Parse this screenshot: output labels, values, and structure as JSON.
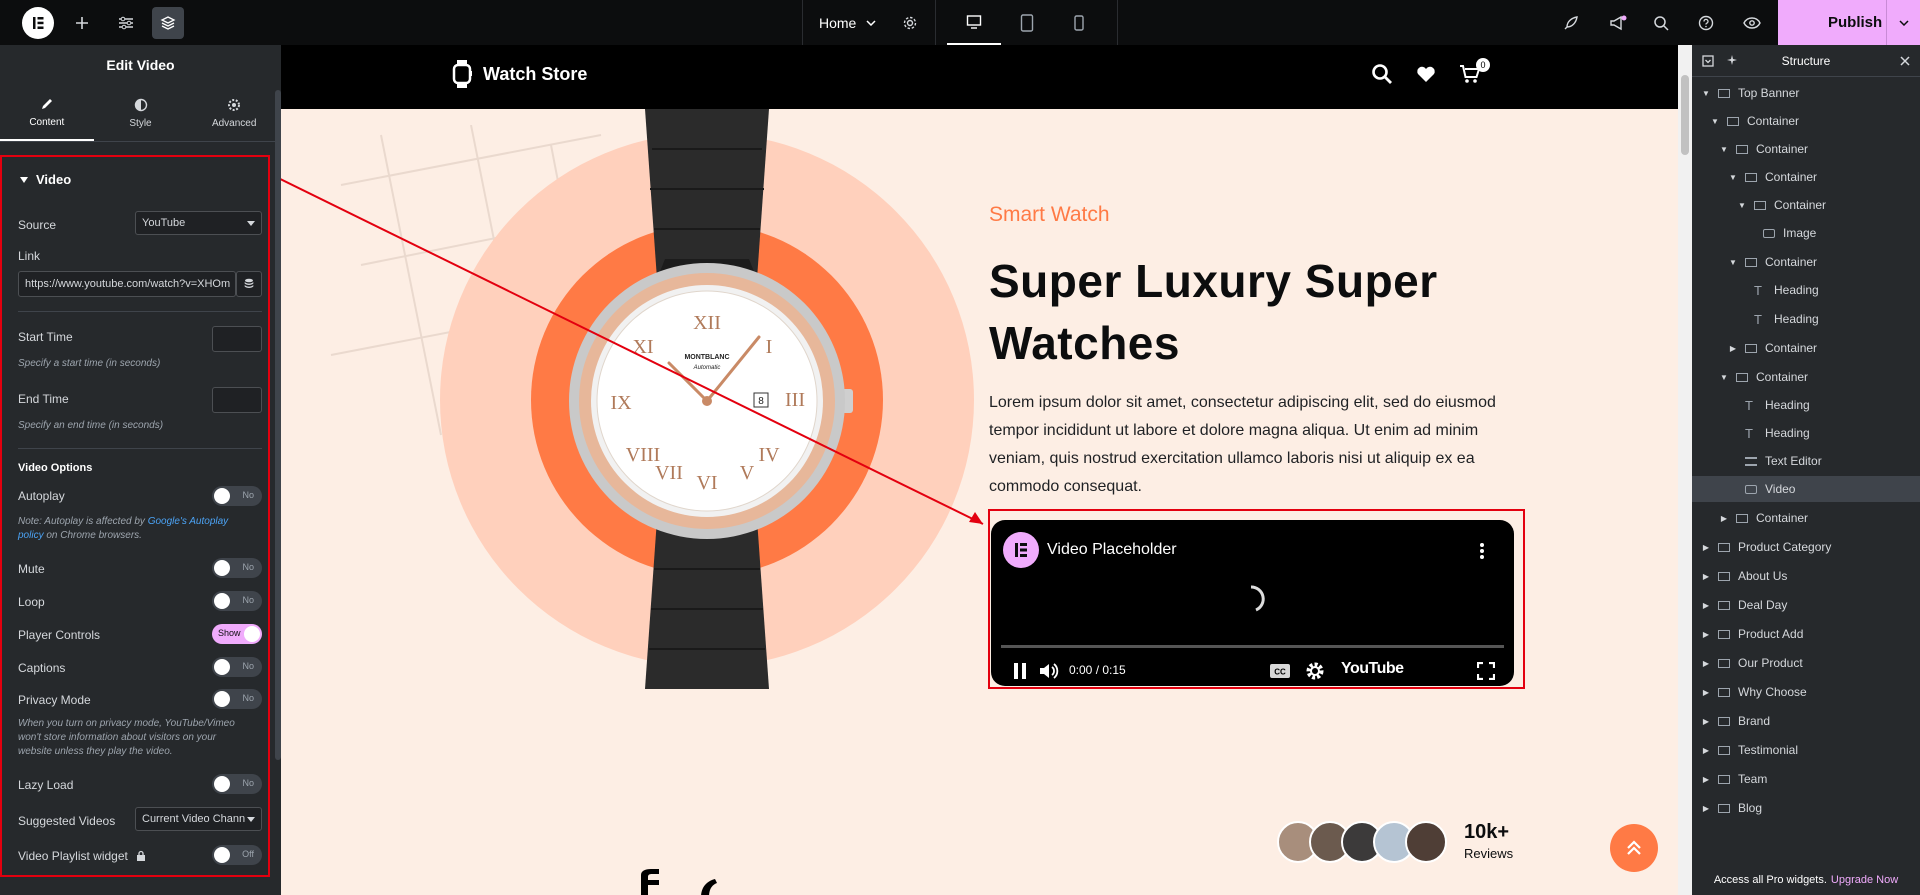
{
  "topbar": {
    "page_selector": "Home",
    "publish": "Publish"
  },
  "panel": {
    "title": "Edit Video",
    "tabs": [
      {
        "label": "Content"
      },
      {
        "label": "Style"
      },
      {
        "label": "Advanced"
      }
    ],
    "section": "Video",
    "source_label": "Source",
    "source_value": "YouTube",
    "link_label": "Link",
    "link_value": "https://www.youtube.com/watch?v=XHOm",
    "start_time_label": "Start Time",
    "start_time_note": "Specify a start time (in seconds)",
    "end_time_label": "End Time",
    "end_time_note": "Specify an end time (in seconds)",
    "video_options": "Video Options",
    "autoplay": {
      "label": "Autoplay",
      "state": "No"
    },
    "autoplay_note_pre": "Note: Autoplay is affected by ",
    "autoplay_note_link": "Google's Autoplay policy",
    "autoplay_note_post": " on Chrome browsers.",
    "mute": {
      "label": "Mute",
      "state": "No"
    },
    "loop": {
      "label": "Loop",
      "state": "No"
    },
    "player_controls": {
      "label": "Player Controls",
      "state": "Show"
    },
    "captions": {
      "label": "Captions",
      "state": "No"
    },
    "privacy": {
      "label": "Privacy Mode",
      "state": "No"
    },
    "privacy_note": "When you turn on privacy mode, YouTube/Vimeo won't store information about visitors on your website unless they play the video.",
    "lazy": {
      "label": "Lazy Load",
      "state": "No"
    },
    "suggested_label": "Suggested Videos",
    "suggested_value": "Current Video Chann",
    "playlist": {
      "label": "Video Playlist widget",
      "state": "Off"
    }
  },
  "site": {
    "brand": "Watch Store",
    "cart_count": "0",
    "eyebrow": "Smart Watch",
    "heading": "Super Luxury Super Watches",
    "paragraph": "Lorem ipsum dolor sit amet, consectetur adipiscing elit, sed do eiusmod tempor incididunt ut labore et dolore magna aliqua. Ut enim ad minim veniam, quis nostrud exercitation ullamco laboris nisi ut aliquip ex ea commodo consequat.",
    "video_title": "Video Placeholder",
    "video_time": "0:00 / 0:15",
    "video_brand": "YouTube",
    "watch_brand": "MONTBLANC",
    "watch_sub": "Automatic",
    "watch_date": "8",
    "reviews_count": "10k+",
    "reviews_label": "Reviews"
  },
  "structure": {
    "title": "Structure",
    "items": [
      {
        "label": "Top Banner",
        "caret": "▼",
        "icon": "container"
      },
      {
        "label": "Container",
        "caret": "▼",
        "icon": "container"
      },
      {
        "label": "Container",
        "caret": "▼",
        "icon": "container"
      },
      {
        "label": "Container",
        "caret": "▼",
        "icon": "container"
      },
      {
        "label": "Container",
        "caret": "▼",
        "icon": "container"
      },
      {
        "label": "Image",
        "caret": "",
        "icon": "image"
      },
      {
        "label": "Container",
        "caret": "▼",
        "icon": "container"
      },
      {
        "label": "Heading",
        "caret": "",
        "icon": "heading"
      },
      {
        "label": "Heading",
        "caret": "",
        "icon": "heading"
      },
      {
        "label": "Container",
        "caret": "▶",
        "icon": "container"
      },
      {
        "label": "Container",
        "caret": "▼",
        "icon": "container"
      },
      {
        "label": "Heading",
        "caret": "",
        "icon": "heading"
      },
      {
        "label": "Heading",
        "caret": "",
        "icon": "heading"
      },
      {
        "label": "Text Editor",
        "caret": "",
        "icon": "text"
      },
      {
        "label": "Video",
        "caret": "",
        "icon": "video"
      },
      {
        "label": "Container",
        "caret": "▶",
        "icon": "container"
      },
      {
        "label": "Product Category",
        "caret": "▶",
        "icon": "container"
      },
      {
        "label": "About Us",
        "caret": "▶",
        "icon": "container"
      },
      {
        "label": "Deal Day",
        "caret": "▶",
        "icon": "container"
      },
      {
        "label": "Product Add",
        "caret": "▶",
        "icon": "container"
      },
      {
        "label": "Our Product",
        "caret": "▶",
        "icon": "container"
      },
      {
        "label": "Why Choose",
        "caret": "▶",
        "icon": "container"
      },
      {
        "label": "Brand",
        "caret": "▶",
        "icon": "container"
      },
      {
        "label": "Testimonial",
        "caret": "▶",
        "icon": "container"
      },
      {
        "label": "Team",
        "caret": "▶",
        "icon": "container"
      },
      {
        "label": "Blog",
        "caret": "▶",
        "icon": "container"
      }
    ],
    "footer_text": "Access all Pro widgets.",
    "footer_link": "Upgrade Now"
  },
  "colors": {
    "accent": "#f0abfc",
    "orange": "#ff7a45",
    "highlight": "#e3000f"
  }
}
